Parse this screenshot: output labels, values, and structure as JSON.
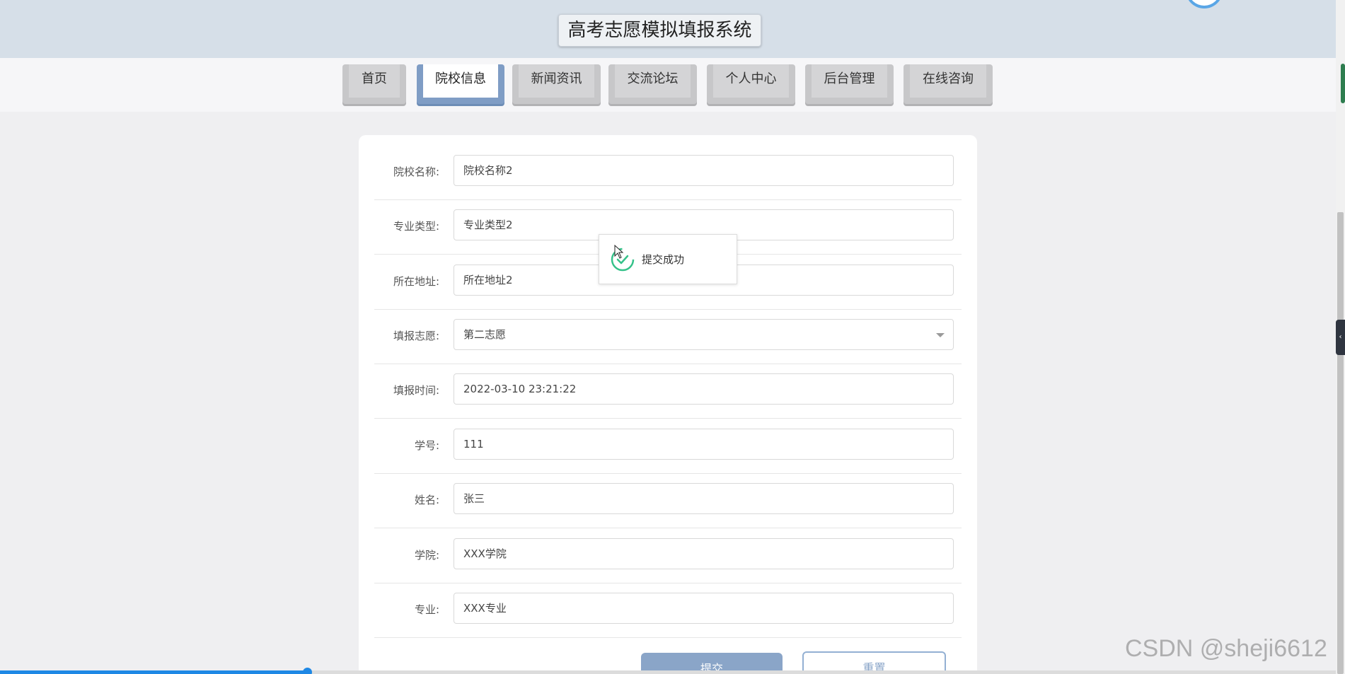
{
  "header": {
    "title": "高考志愿模拟填报系统"
  },
  "nav": {
    "items": [
      {
        "label": "首页",
        "active": false
      },
      {
        "label": "院校信息",
        "active": true
      },
      {
        "label": "新闻资讯",
        "active": false
      },
      {
        "label": "交流论坛",
        "active": false
      },
      {
        "label": "个人中心",
        "active": false
      },
      {
        "label": "后台管理",
        "active": false
      },
      {
        "label": "在线咨询",
        "active": false
      }
    ]
  },
  "form": {
    "fields": [
      {
        "label": "院校名称:",
        "value": "院校名称2",
        "type": "text"
      },
      {
        "label": "专业类型:",
        "value": "专业类型2",
        "type": "text"
      },
      {
        "label": "所在地址:",
        "value": "所在地址2",
        "type": "text"
      },
      {
        "label": "填报志愿:",
        "value": "第二志愿",
        "type": "select"
      },
      {
        "label": "填报时间:",
        "value": "2022-03-10 23:21:22",
        "type": "text"
      },
      {
        "label": "学号:",
        "value": "111",
        "type": "text"
      },
      {
        "label": "姓名:",
        "value": "张三",
        "type": "text"
      },
      {
        "label": "学院:",
        "value": "XXX学院",
        "type": "text"
      },
      {
        "label": "专业:",
        "value": "XXX专业",
        "type": "text"
      }
    ],
    "submit_label": "提交",
    "reset_label": "重置"
  },
  "toast": {
    "message": "提交成功",
    "icon": "loading-success-icon"
  },
  "progress": {
    "fraction": 0.23
  },
  "watermark": "CSDN @sheji6612",
  "colors": {
    "header_bg": "#d6dfe8",
    "nav_active": "#7f9dc5",
    "nav_inactive": "#c7c7c9",
    "submit_bg": "#8aa5c8",
    "toast_icon": "#36c28a",
    "progress": "#1e88e5"
  }
}
